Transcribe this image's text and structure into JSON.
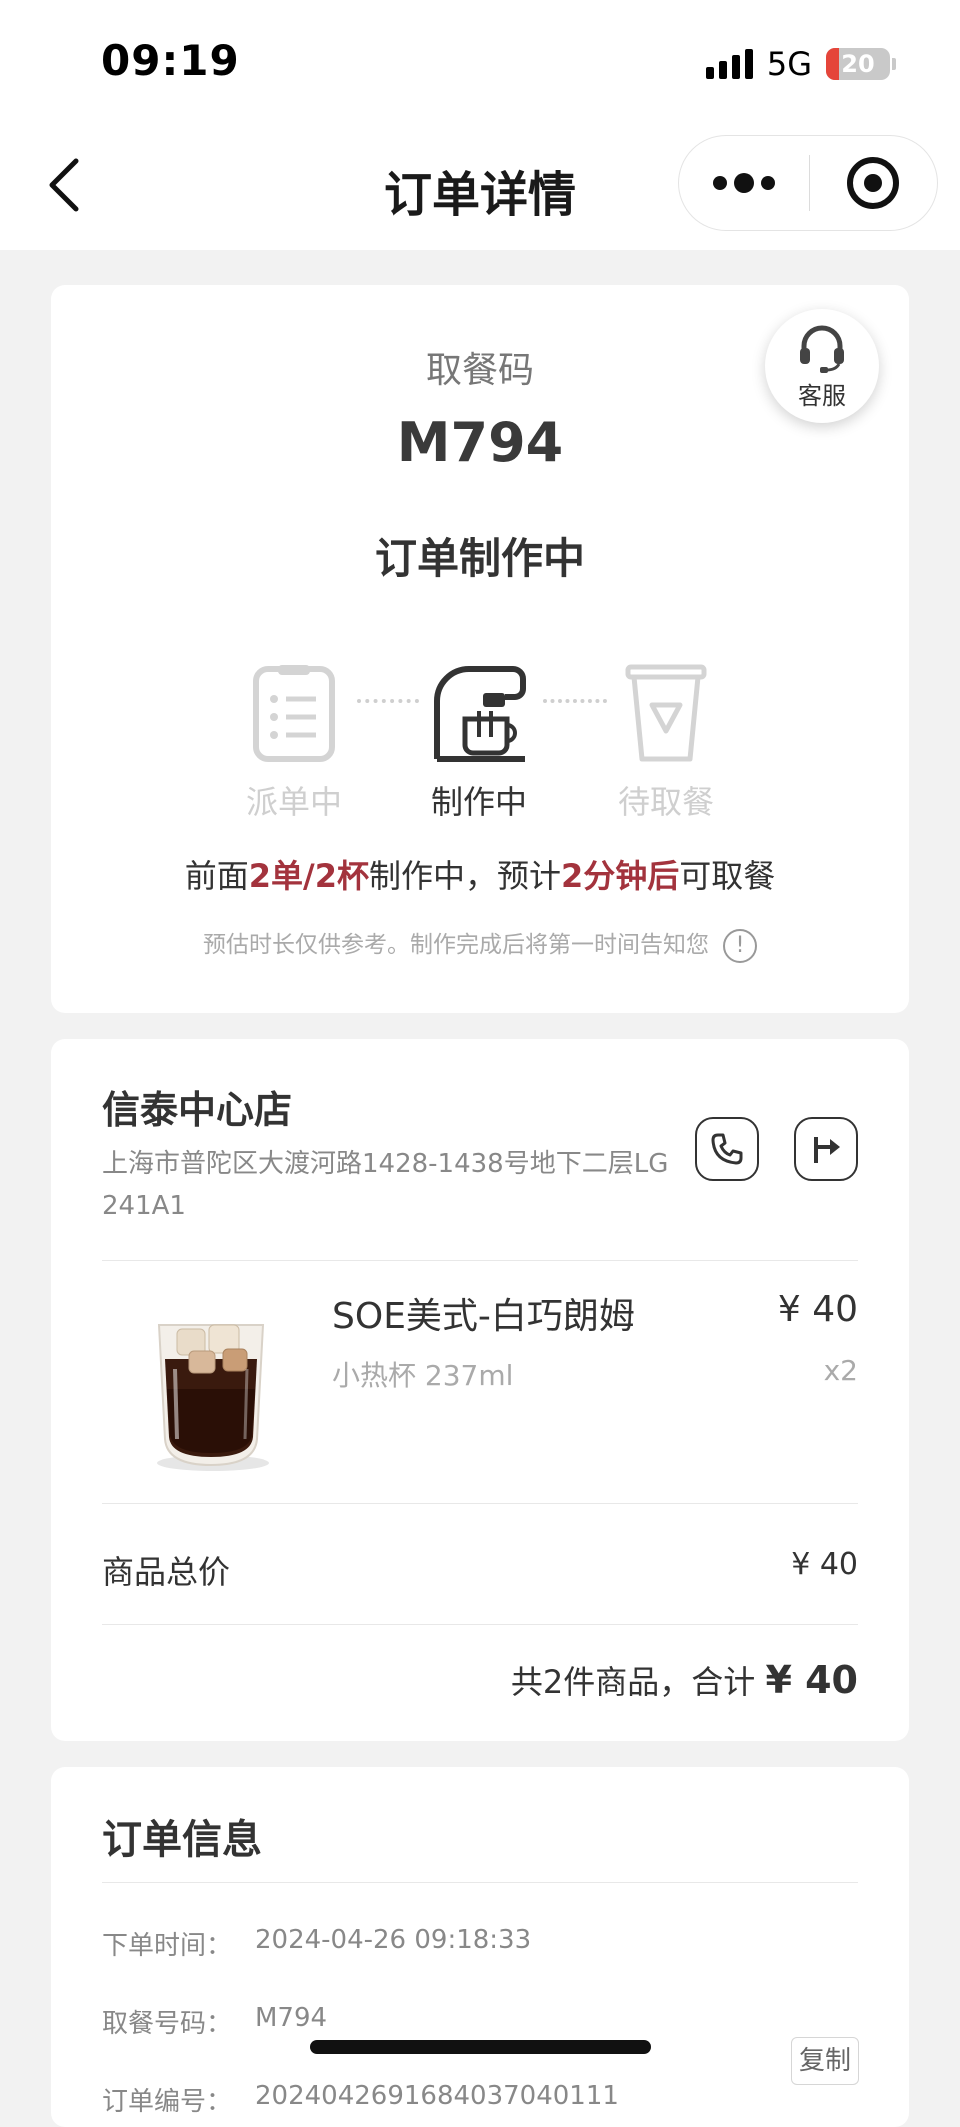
{
  "status_bar": {
    "time": "09:19",
    "network": "5G",
    "battery": "20",
    "battery_level": 0.2
  },
  "nav": {
    "title": "订单详情"
  },
  "pickup": {
    "label": "取餐码",
    "code": "M794",
    "status": "订单制作中",
    "service_label": "客服",
    "steps": [
      {
        "label": "派单中",
        "state": "done",
        "icon": "clipboard-icon"
      },
      {
        "label": "制作中",
        "state": "active",
        "icon": "coffee-machine-icon"
      },
      {
        "label": "待取餐",
        "state": "pending",
        "icon": "cup-icon"
      }
    ],
    "queue": {
      "prefix": "前面",
      "orders": "2单/2杯",
      "middle": "制作中，预计",
      "eta": "2分钟后",
      "suffix": "可取餐"
    },
    "note": "预估时长仅供参考。制作完成后将第一时间告知您",
    "highlight_color": "#a3333d"
  },
  "store": {
    "name": "信泰中心店",
    "address": "上海市普陀区大渡河路1428-1438号地下二层LG241A1"
  },
  "items": [
    {
      "name": "SOE美式-白巧朗姆",
      "spec": "小热杯 237ml",
      "price": "¥ 40",
      "qty": "x2"
    }
  ],
  "summary": {
    "subtotal_label": "商品总价",
    "subtotal_value": "¥ 40",
    "total_prefix": "共2件商品，合计 ",
    "total_amount": "¥ 40"
  },
  "order_info": {
    "title": "订单信息",
    "rows": [
      {
        "label": "下单时间：",
        "value": "2024-04-26 09:18:33"
      },
      {
        "label": "取餐号码：",
        "value": "M794"
      },
      {
        "label": "订单编号：",
        "value": "2024042691684037040111"
      }
    ],
    "copy_label": "复制"
  }
}
